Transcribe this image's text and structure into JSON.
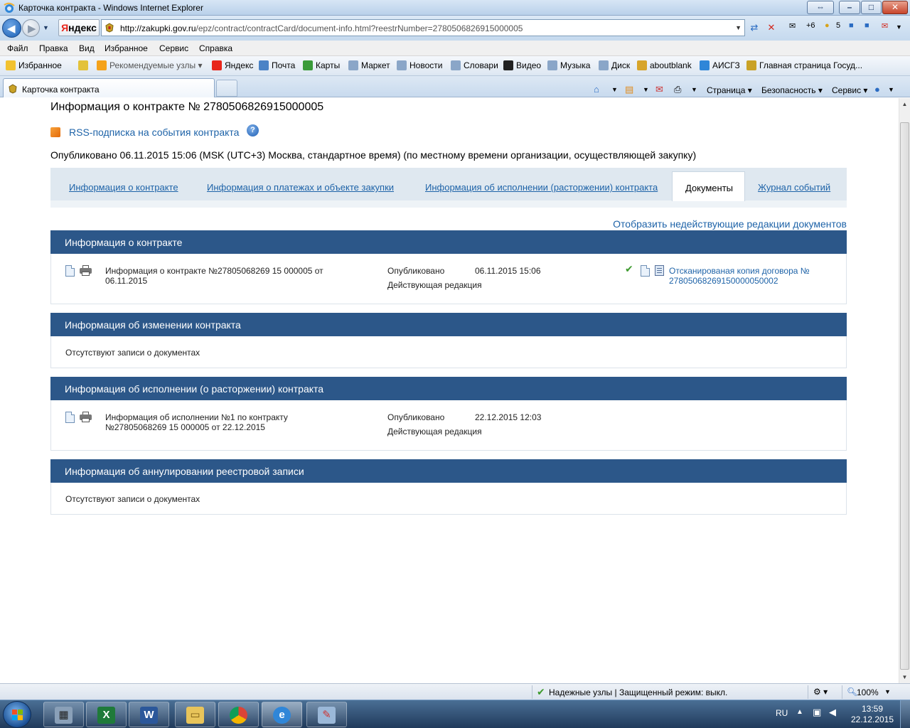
{
  "window": {
    "title": "Карточка контракта - Windows Internet Explorer"
  },
  "addressbar": {
    "yandex_label": "Яндекс",
    "url_host": "http://zakupki.gov.ru",
    "url_path": "/epz/contract/contractCard/document-info.html?reestrNumber=2780506826915000005",
    "mail_count": "+6",
    "notify_count": "5"
  },
  "menu": {
    "items": [
      "Файл",
      "Правка",
      "Вид",
      "Избранное",
      "Сервис",
      "Справка"
    ]
  },
  "favorites": {
    "favorites_label": "Избранное",
    "recommended_label": "Рекомендуемые узлы",
    "links": [
      "Яндекс",
      "Почта",
      "Карты",
      "Маркет",
      "Новости",
      "Словари",
      "Видео",
      "Музыка",
      "Диск",
      "aboutblank",
      "АИСГЗ",
      "Главная страница Госуд..."
    ]
  },
  "tabs": {
    "active_tab": "Карточка контракта"
  },
  "commandbar": {
    "page": "Страница",
    "safety": "Безопасность",
    "tools": "Сервис"
  },
  "page": {
    "title": "Информация о контракте № 2780506826915000005",
    "rss_link": "RSS-подписка на события контракта",
    "published_line": "Опубликовано 06.11.2015 15:06 (MSK (UTC+3) Москва, стандартное время) (по местному времени организации, осуществляющей закупку)",
    "tabs": [
      "Информация о контракте",
      "Информация о платежах и объекте закупки",
      "Информация об исполнении (расторжении) контракта",
      "Документы",
      "Журнал событий"
    ],
    "show_inactive_link": "Отобразить недействующие редакции документов",
    "sections": [
      {
        "heading": "Информация о контракте",
        "doc_title_line1": "Информация о контракте №27805068269 15 000005 от",
        "doc_title_line2": "06.11.2015",
        "status_label": "Опубликовано",
        "status_date": "06.11.2015 15:06",
        "edition": "Действующая редакция",
        "attachment_line1": "Отсканированая копия договора №",
        "attachment_line2": "27805068269150000050002"
      },
      {
        "heading": "Информация об изменении контракта",
        "empty_text": "Отсутствуют записи о документах"
      },
      {
        "heading": "Информация об исполнении (о расторжении) контракта",
        "doc_title_line1": "Информация об исполнении №1 по контракту",
        "doc_title_line2": "№27805068269 15 000005 от 22.12.2015",
        "status_label": "Опубликовано",
        "status_date": "22.12.2015 12:03",
        "edition": "Действующая редакция"
      },
      {
        "heading": "Информация об аннулировании реестровой записи",
        "empty_text": "Отсутствуют записи о документах"
      }
    ]
  },
  "statusbar": {
    "zone": "Надежные узлы | Защищенный режим: выкл.",
    "zoom": "100%"
  },
  "taskbar": {
    "lang": "RU",
    "time": "13:59",
    "date": "22.12.2015"
  },
  "colors": {
    "section_header": "#2c5789",
    "link": "#1e63a8",
    "tab_strip": "#dfe8f0"
  }
}
